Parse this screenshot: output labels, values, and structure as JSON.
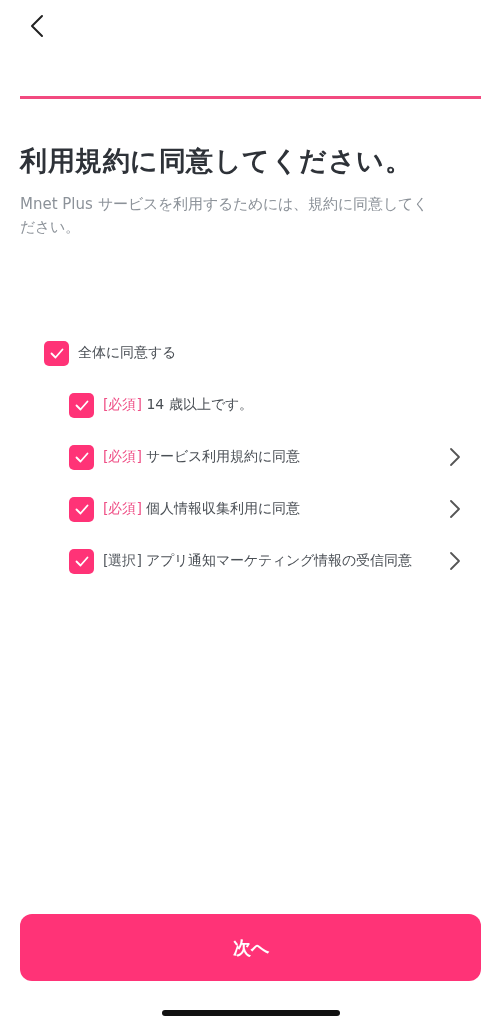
{
  "title": "利用規約に同意してください。",
  "subtitle": "Mnet Plus サービスを利用するためには、規約に同意してください。",
  "agree_all": {
    "label": "全体に同意する",
    "checked": true
  },
  "terms": [
    {
      "kind": "required",
      "tag": "[必須]",
      "label": "14 歳以上です。",
      "checked": true,
      "has_detail": false
    },
    {
      "kind": "required",
      "tag": "[必須]",
      "label": "サービス利用規約に同意",
      "checked": true,
      "has_detail": true
    },
    {
      "kind": "required",
      "tag": "[必須]",
      "label": "個人情報収集利用に同意",
      "checked": true,
      "has_detail": true
    },
    {
      "kind": "optional",
      "tag": "[選択]",
      "label": "アプリ通知マーケティング情報の受信同意",
      "checked": true,
      "has_detail": true
    }
  ],
  "next_button": "次へ"
}
